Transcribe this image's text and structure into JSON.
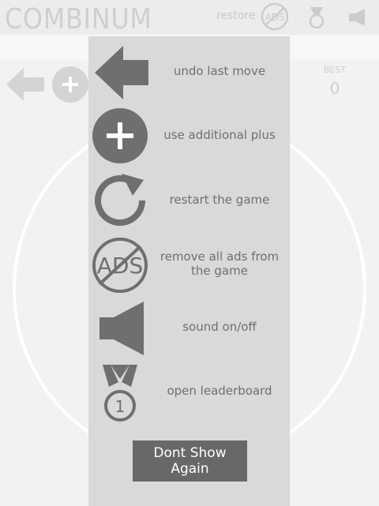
{
  "app": {
    "title": "COMBINUM",
    "restore_label": "restore"
  },
  "icons": {
    "ads_text": "ADS",
    "medal_text": "1"
  },
  "score": {
    "best_label": "BEST",
    "best_value": "0"
  },
  "help": {
    "items": [
      {
        "icon": "undo-arrow-icon",
        "label": "undo last move"
      },
      {
        "icon": "plus-icon",
        "label": "use additional plus"
      },
      {
        "icon": "restart-icon",
        "label": "restart the game"
      },
      {
        "icon": "no-ads-icon",
        "label": "remove all ads from the game"
      },
      {
        "icon": "sound-icon",
        "label": "sound on/off"
      },
      {
        "icon": "medal-icon",
        "label": "open leaderboard"
      }
    ],
    "dont_show_label": "Dont Show Again"
  },
  "colors": {
    "overlay": "#d9d9d9",
    "icon": "#6f6f6f",
    "button": "#686868",
    "background": "#f2f2f2"
  }
}
